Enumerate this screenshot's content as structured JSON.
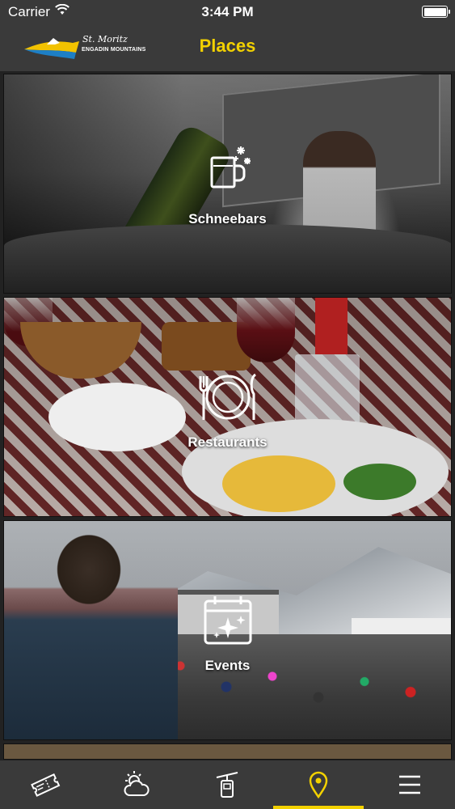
{
  "status_bar": {
    "carrier": "Carrier",
    "time": "3:44 PM",
    "wifi_icon": "wifi-icon",
    "battery_icon": "battery-icon"
  },
  "header": {
    "logo": {
      "script": "St. Moritz",
      "subtitle": "ENGADIN MOUNTAINS"
    },
    "title": "Places",
    "title_color": "#f2d100"
  },
  "tiles": [
    {
      "label": "Schneebars",
      "icon": "beer-snowflake-icon"
    },
    {
      "label": "Restaurants",
      "icon": "plate-cutlery-icon"
    },
    {
      "label": "Events",
      "icon": "calendar-sparkle-icon"
    }
  ],
  "tab_bar": {
    "accent": "#f2d100",
    "tabs": [
      {
        "icon": "ticket-icon",
        "active": false
      },
      {
        "icon": "weather-icon",
        "active": false
      },
      {
        "icon": "gondola-icon",
        "active": false
      },
      {
        "icon": "location-pin-icon",
        "active": true
      },
      {
        "icon": "menu-icon",
        "active": false
      }
    ]
  }
}
